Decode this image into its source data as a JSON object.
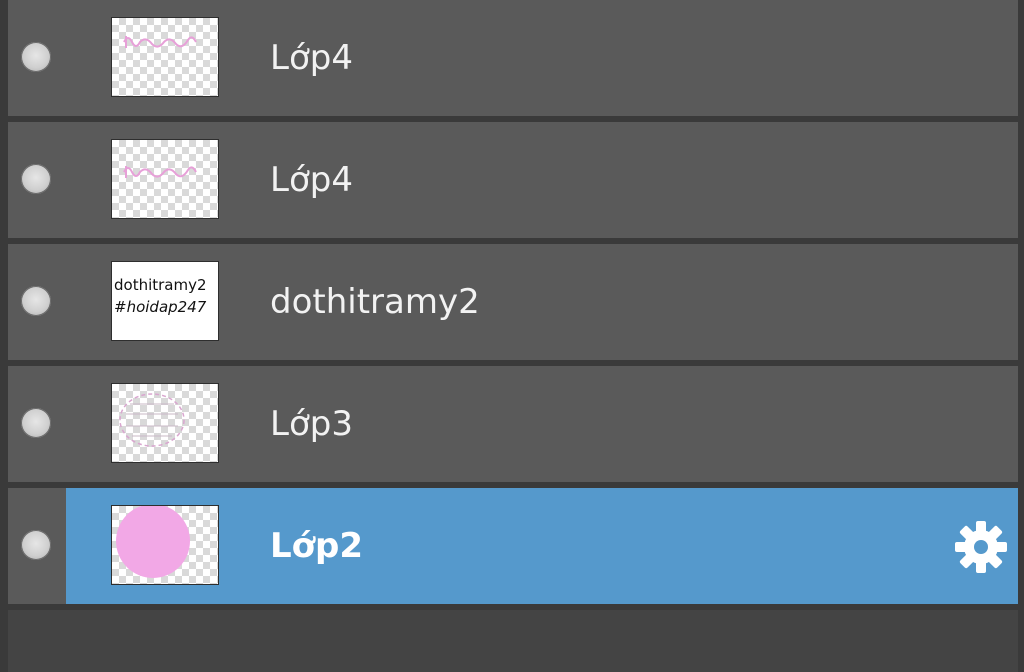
{
  "layers_panel": {
    "layers": [
      {
        "name": "Lớp4",
        "thumbnail": "pink-scribble-on-transparent",
        "selected": false
      },
      {
        "name": "Lớp4",
        "thumbnail": "pink-scribble-on-transparent",
        "selected": false
      },
      {
        "name": "dothitramy2",
        "thumbnail": "text-dothitramy2-hoidap247",
        "thumb_text_line1": "dothitramy2",
        "thumb_text_line2": "#hoidap247",
        "selected": false
      },
      {
        "name": "Lớp3",
        "thumbnail": "pink-circle-outline-on-transparent",
        "selected": false
      },
      {
        "name": "Lớp2",
        "thumbnail": "pink-filled-circle-on-transparent",
        "selected": true
      }
    ],
    "icons": {
      "visibility": "visibility-dot-icon",
      "settings": "gear-icon"
    },
    "colors": {
      "row_bg": "#5a5a5a",
      "selected_bg": "#5599cc",
      "separator": "#3a3a3a",
      "thumb_pink": "#f2a8e6"
    }
  }
}
